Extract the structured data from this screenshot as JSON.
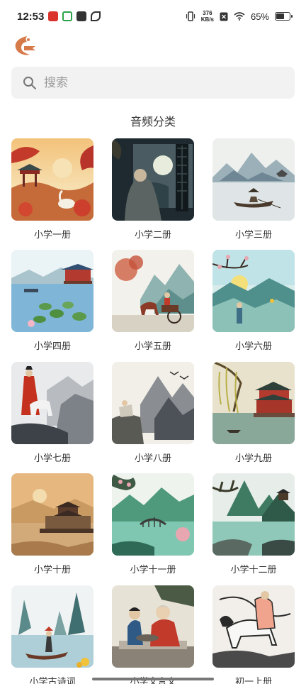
{
  "status": {
    "time": "12:53",
    "netspeed_value": "376",
    "netspeed_unit": "KB/s",
    "battery": "65%",
    "battery_level": 0.65
  },
  "search": {
    "placeholder": "搜索"
  },
  "section_title": "音频分类",
  "categories": [
    {
      "label": "小学一册",
      "scene": "red-pavilion-sunset"
    },
    {
      "label": "小学二册",
      "scene": "moon-window-sage"
    },
    {
      "label": "小学三册",
      "scene": "fisherman-boat"
    },
    {
      "label": "小学四册",
      "scene": "lotus-lake-pavilion"
    },
    {
      "label": "小学五册",
      "scene": "horse-cart-mountains"
    },
    {
      "label": "小学六册",
      "scene": "plum-blossom-scholar"
    },
    {
      "label": "小学七册",
      "scene": "red-robe-horseman"
    },
    {
      "label": "小学八册",
      "scene": "cliff-scholar-geese"
    },
    {
      "label": "小学九册",
      "scene": "willow-temple"
    },
    {
      "label": "小学十册",
      "scene": "desert-fortress"
    },
    {
      "label": "小学十一册",
      "scene": "green-bridge-valley"
    },
    {
      "label": "小学十二册",
      "scene": "pine-lake-mountains"
    },
    {
      "label": "小学古诗词",
      "scene": "river-boatman"
    },
    {
      "label": "小学文言文",
      "scene": "elder-grinding-stone"
    },
    {
      "label": "初一上册",
      "scene": "white-horse-rider"
    }
  ]
}
